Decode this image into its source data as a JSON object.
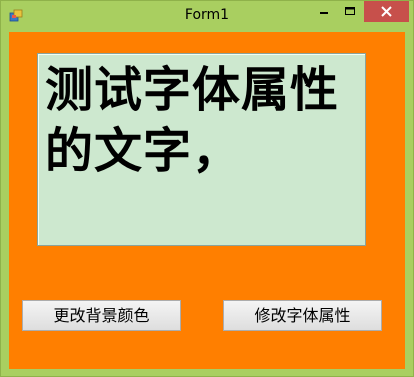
{
  "window": {
    "title": "Form1",
    "controls": {
      "minimize": "minimize",
      "maximize": "maximize",
      "close": "close"
    }
  },
  "colors": {
    "frame": "#a9cf60",
    "client_background": "#ff7f00",
    "label_background": "#cde8cf",
    "close_button": "#c7504b"
  },
  "label": {
    "text": "测试字体属性的文字，"
  },
  "buttons": {
    "change_background": "更改背景颜色",
    "change_font": "修改字体属性"
  }
}
